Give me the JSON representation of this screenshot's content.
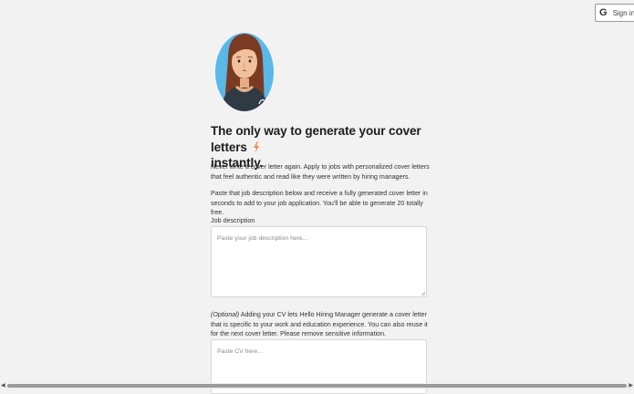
{
  "header": {
    "signin_label": "Sign in",
    "google_glyph": "G"
  },
  "hero": {
    "headline": "The only way to generate your cover letters",
    "headline_end": "instantly.",
    "bolt_icon": "lightning-bolt-icon",
    "bolt_color": "#f08a4b"
  },
  "intro": {
    "paragraph1": "Never write a cover letter again. Apply to jobs with personalized cover letters that feel authentic and read like they were written by hiring managers.",
    "paragraph2": "Paste that job description below and receive a fully generated cover letter in seconds to add to your job application. You'll be able to generate 20 totally free."
  },
  "job_form": {
    "label": "Job description",
    "placeholder": "Paste your job description here..."
  },
  "cv_form": {
    "optional_tag": "(Optional)",
    "description": " Adding your CV lets Hello Hiring Manager generate a cover letter that is specific to your work and education experience. You can also reuse it for the next cover letter. Please remove sensitive information.",
    "placeholder": "Paste CV here..."
  },
  "colors": {
    "background": "#f2f2f2",
    "avatar_bg": "#5ab8e8",
    "hair": "#7a3b22",
    "skin": "#f2c09a"
  }
}
